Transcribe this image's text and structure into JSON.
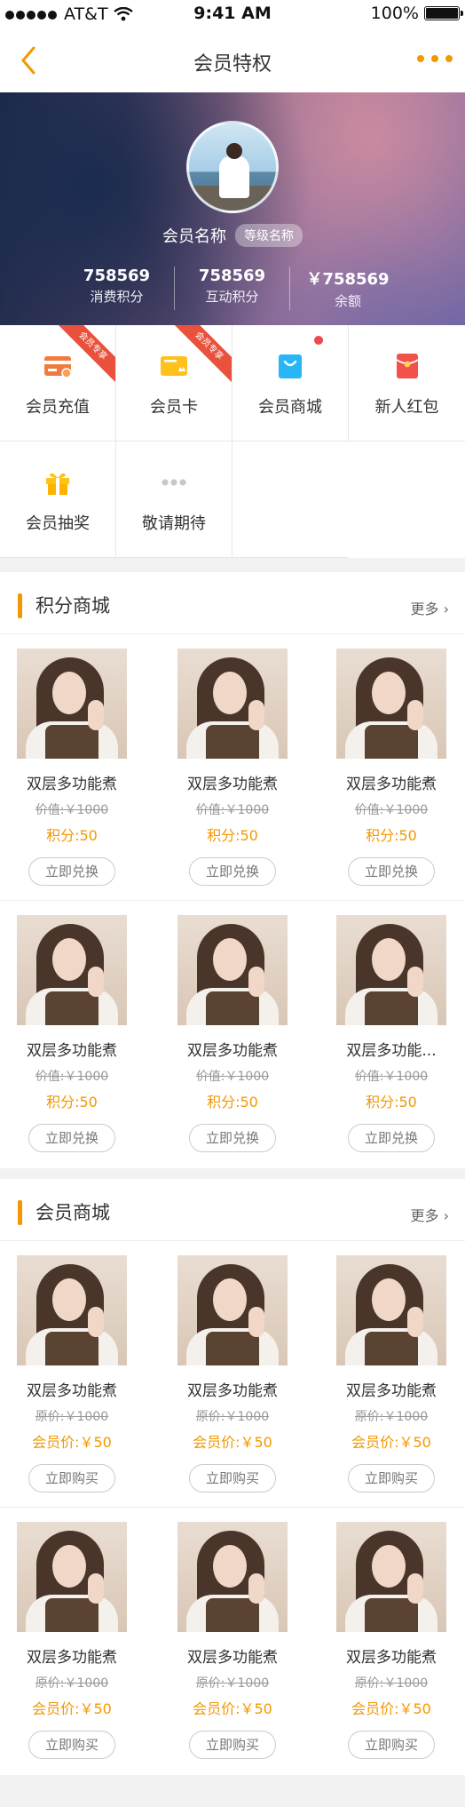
{
  "status_bar": {
    "carrier": "AT&T",
    "time": "9:41 AM",
    "battery": "100%"
  },
  "nav": {
    "title": "会员特权"
  },
  "profile": {
    "name": "会员名称",
    "level": "等级名称",
    "stats": [
      {
        "value": "758569",
        "label": "消费积分"
      },
      {
        "value": "758569",
        "label": "互动积分"
      },
      {
        "value": "￥758569",
        "label": "余额"
      }
    ]
  },
  "menu": [
    {
      "label": "会员充值",
      "ribbon": "会员专享"
    },
    {
      "label": "会员卡",
      "ribbon": "会员专享"
    },
    {
      "label": "会员商城"
    },
    {
      "label": "新人红包"
    },
    {
      "label": "会员抽奖"
    },
    {
      "label": "敬请期待"
    }
  ],
  "points_mall": {
    "title": "积分商城",
    "more": "更多 ›",
    "rows": [
      [
        {
          "name": "双层多功能煮",
          "orig": "价值:￥1000",
          "price": "积分:50",
          "btn": "立即兑换"
        },
        {
          "name": "双层多功能煮",
          "orig": "价值:￥1000",
          "price": "积分:50",
          "btn": "立即兑换"
        },
        {
          "name": "双层多功能煮",
          "orig": "价值:￥1000",
          "price": "积分:50",
          "btn": "立即兑换"
        }
      ],
      [
        {
          "name": "双层多功能煮",
          "orig": "价值:￥1000",
          "price": "积分:50",
          "btn": "立即兑换"
        },
        {
          "name": "双层多功能煮",
          "orig": "价值:￥1000",
          "price": "积分:50",
          "btn": "立即兑换"
        },
        {
          "name": "双层多功能...",
          "orig": "价值:￥1000",
          "price": "积分:50",
          "btn": "立即兑换"
        }
      ]
    ]
  },
  "member_mall": {
    "title": "会员商城",
    "more": "更多 ›",
    "rows": [
      [
        {
          "name": "双层多功能煮",
          "orig": "原价:￥1000",
          "price": "会员价:￥50",
          "btn": "立即购买"
        },
        {
          "name": "双层多功能煮",
          "orig": "原价:￥1000",
          "price": "会员价:￥50",
          "btn": "立即购买"
        },
        {
          "name": "双层多功能煮",
          "orig": "原价:￥1000",
          "price": "会员价:￥50",
          "btn": "立即购买"
        }
      ],
      [
        {
          "name": "双层多功能煮",
          "orig": "原价:￥1000",
          "price": "会员价:￥50",
          "btn": "立即购买"
        },
        {
          "name": "双层多功能煮",
          "orig": "原价:￥1000",
          "price": "会员价:￥50",
          "btn": "立即购买"
        },
        {
          "name": "双层多功能煮",
          "orig": "原价:￥1000",
          "price": "会员价:￥50",
          "btn": "立即购买"
        }
      ]
    ]
  },
  "colors": {
    "accent": "#f39800",
    "ribbon": "#e8523d"
  }
}
